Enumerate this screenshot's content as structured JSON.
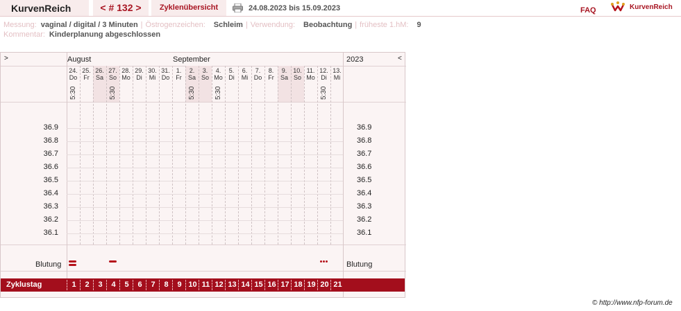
{
  "header": {
    "brand": "KurvenReich",
    "cycle_nav": "< # 132 >",
    "overview": "Zyklenübersicht",
    "date_range": "24.08.2023 bis 15.09.2023",
    "faq": "FAQ",
    "logo_text": "KurvenReich"
  },
  "info": {
    "messung_label": "Messung:",
    "messung_value": "vaginal / digital / 3 Minuten",
    "oestrogen_label": "Östrogenzeichen:",
    "oestrogen_value": "Schleim",
    "verwendung_label": "Verwendung:",
    "verwendung_value": "Beobachtung",
    "hm_label": "früheste 1.hM:",
    "hm_value": "9",
    "kommentar_label": "Kommentar:",
    "kommentar_value": "Kinderplanung abgeschlossen"
  },
  "chart": {
    "nav_next": ">",
    "nav_prev": "<",
    "month1": "August",
    "month2": "September",
    "year": "2023",
    "days": [
      {
        "num": "24.",
        "name": "Do",
        "weekend": false,
        "time": "5:30"
      },
      {
        "num": "25.",
        "name": "Fr",
        "weekend": false,
        "time": ""
      },
      {
        "num": "26.",
        "name": "Sa",
        "weekend": true,
        "time": ""
      },
      {
        "num": "27.",
        "name": "So",
        "weekend": true,
        "time": "5:30"
      },
      {
        "num": "28.",
        "name": "Mo",
        "weekend": false,
        "time": ""
      },
      {
        "num": "29.",
        "name": "Di",
        "weekend": false,
        "time": ""
      },
      {
        "num": "30.",
        "name": "Mi",
        "weekend": false,
        "time": ""
      },
      {
        "num": "31.",
        "name": "Do",
        "weekend": false,
        "time": ""
      },
      {
        "num": "1.",
        "name": "Fr",
        "weekend": false,
        "time": ""
      },
      {
        "num": "2.",
        "name": "Sa",
        "weekend": true,
        "time": "5:30"
      },
      {
        "num": "3.",
        "name": "So",
        "weekend": true,
        "time": ""
      },
      {
        "num": "4.",
        "name": "Mo",
        "weekend": false,
        "time": "5:30"
      },
      {
        "num": "5.",
        "name": "Di",
        "weekend": false,
        "time": ""
      },
      {
        "num": "6.",
        "name": "Mi",
        "weekend": false,
        "time": ""
      },
      {
        "num": "7.",
        "name": "Do",
        "weekend": false,
        "time": ""
      },
      {
        "num": "8.",
        "name": "Fr",
        "weekend": false,
        "time": ""
      },
      {
        "num": "9.",
        "name": "Sa",
        "weekend": true,
        "time": ""
      },
      {
        "num": "10.",
        "name": "So",
        "weekend": true,
        "time": ""
      },
      {
        "num": "11.",
        "name": "Mo",
        "weekend": false,
        "time": ""
      },
      {
        "num": "12.",
        "name": "Di",
        "weekend": false,
        "time": "5:30"
      },
      {
        "num": "13.",
        "name": "Mi",
        "weekend": false,
        "time": ""
      }
    ],
    "temps": [
      "36.9",
      "36.8",
      "36.7",
      "36.6",
      "36.5",
      "36.4",
      "36.3",
      "36.2",
      "36.1"
    ],
    "bleeding_label": "Blutung",
    "bleeding": [
      {
        "day": 1,
        "type": "double"
      },
      {
        "day": 4,
        "type": "single"
      },
      {
        "day": 20,
        "type": "dots"
      }
    ],
    "cycle_label": "Zyklustag",
    "cycle_days": [
      "1",
      "2",
      "3",
      "4",
      "5",
      "6",
      "7",
      "8",
      "9",
      "10",
      "11",
      "12",
      "13",
      "14",
      "15",
      "16",
      "17",
      "18",
      "19",
      "20",
      "21"
    ],
    "accent_color": "#a30e1c"
  },
  "footer": {
    "copyright": "© http://www.nfp-forum.de"
  }
}
